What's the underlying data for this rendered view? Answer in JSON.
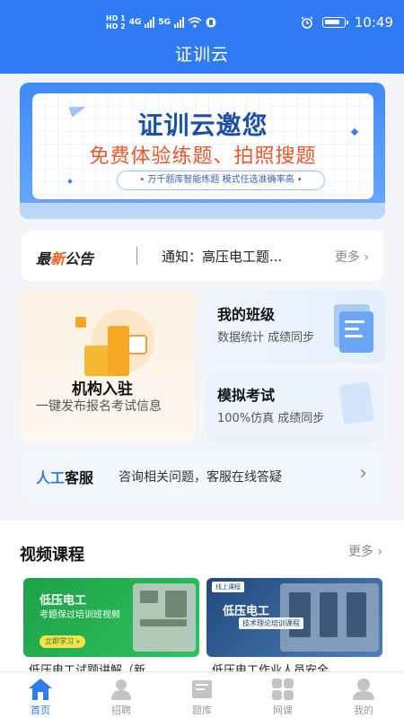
{
  "status_bar": {
    "hd1": "HD 1",
    "hd2": "HD 2",
    "net1": "4G",
    "net2": "5G",
    "time": "10:49"
  },
  "app": {
    "title": "证训云"
  },
  "banner": {
    "headline": "证训云邀您",
    "subline": "免费体验练题、拍照搜题",
    "pill": "• 万千题库智能练题  模式任选准确率高 •"
  },
  "notice": {
    "brand_a": "最",
    "brand_b": "新",
    "brand_c": "公告",
    "text": "通知：高压电工题...",
    "more": "更多"
  },
  "cards": {
    "institution": {
      "title": "机构入驻",
      "desc": "一键发布报名考试信息"
    },
    "my_class": {
      "title": "我的班级",
      "desc": "数据统计 成绩同步"
    },
    "mock_exam": {
      "title": "模拟考试",
      "desc": "100%仿真 成绩同步"
    }
  },
  "service": {
    "brand_a": "人工",
    "brand_b": "客服",
    "text": "咨询相关问题，客服在线答疑"
  },
  "videos": {
    "heading": "视频课程",
    "more": "更多",
    "items": [
      {
        "thumb_title": "低压电工",
        "thumb_sub": "考题保过培训班视频",
        "thumb_btn": "立即学习 »",
        "caption": "低压电工试题讲解（新..."
      },
      {
        "thumb_tag": "线上课程",
        "thumb_title": "低压电工",
        "thumb_sub": "技术理论培训课程",
        "caption": "低压电工作业人员安全..."
      }
    ]
  },
  "tabs": [
    {
      "label": "首页",
      "icon": "home-icon",
      "active": true
    },
    {
      "label": "招聘",
      "icon": "person-icon",
      "active": false
    },
    {
      "label": "题库",
      "icon": "book-icon",
      "active": false
    },
    {
      "label": "网课",
      "icon": "grid-icon",
      "active": false
    },
    {
      "label": "我的",
      "icon": "user-icon",
      "active": false
    }
  ],
  "colors": {
    "primary": "#2f7bf6",
    "accent": "#f45a24"
  }
}
